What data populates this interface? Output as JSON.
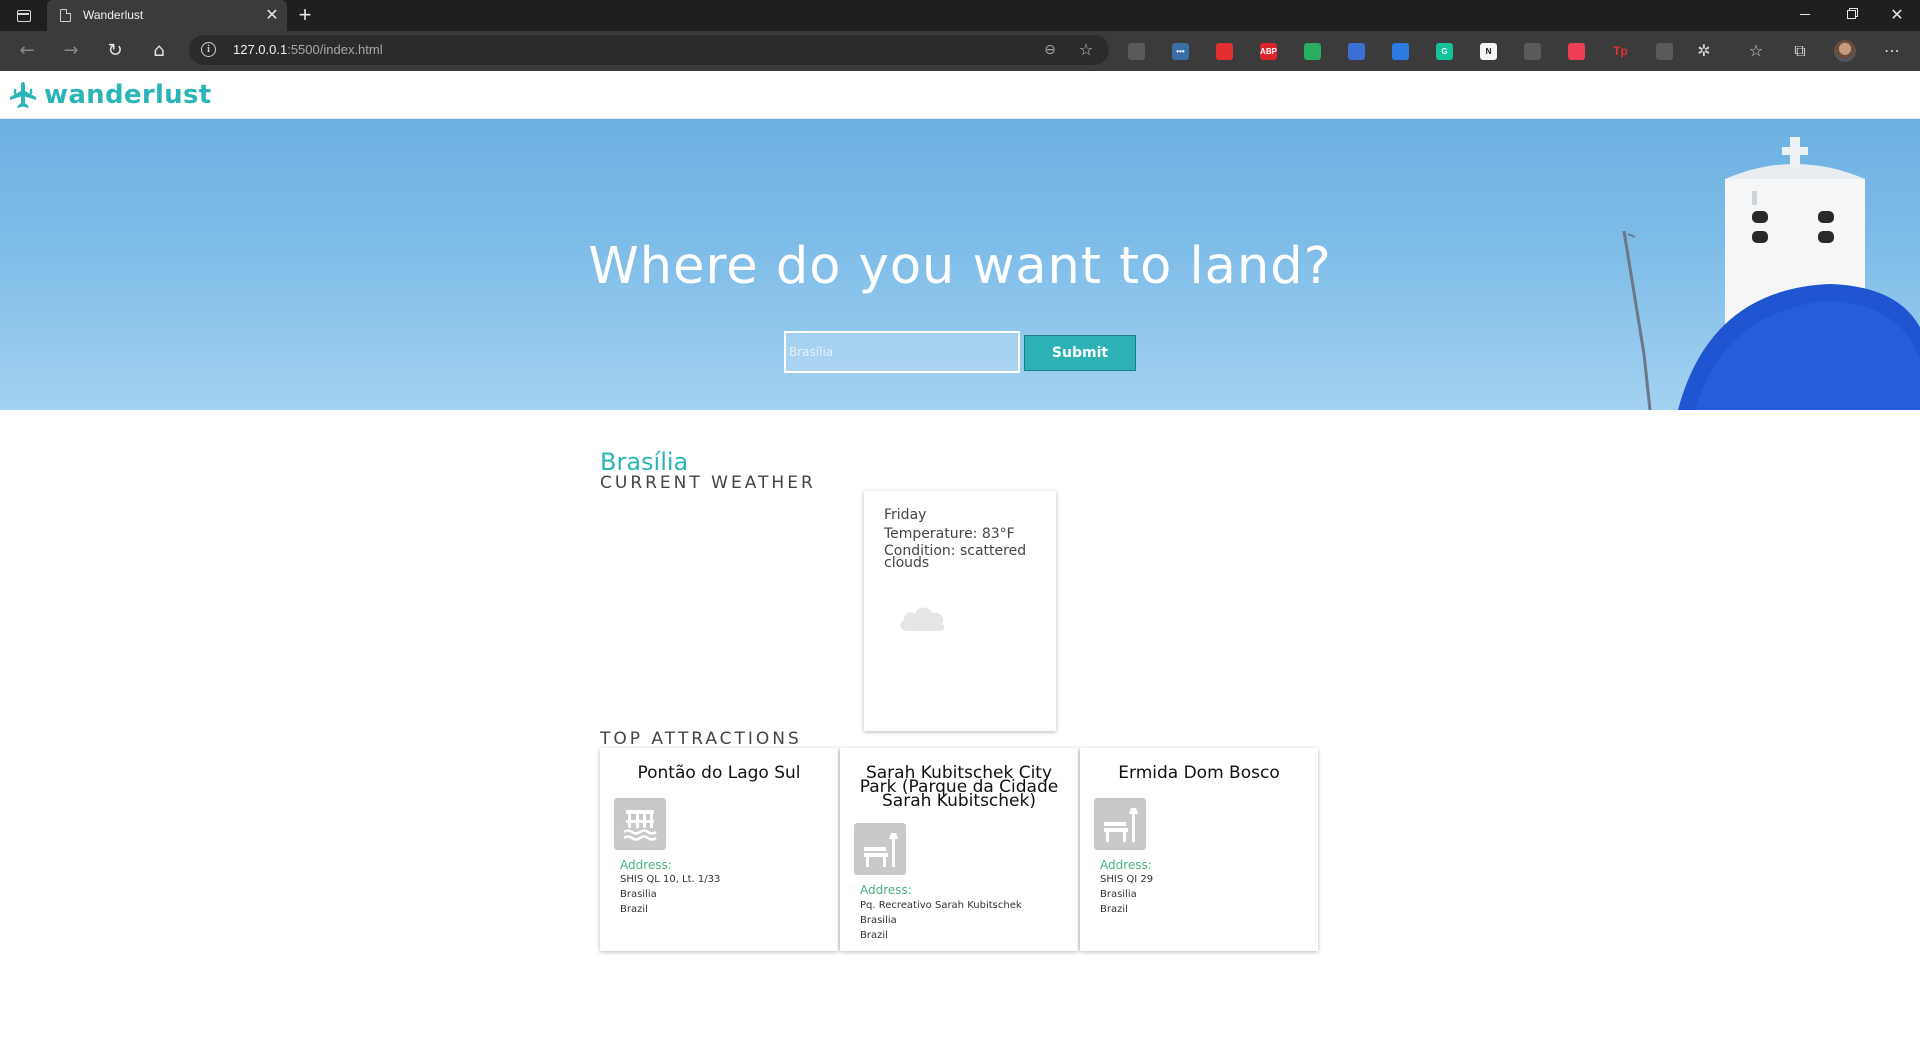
{
  "browser": {
    "tab_title": "Wanderlust",
    "url_host": "127.0.0.1",
    "url_rest": ":5500/index.html",
    "extensions": [
      {
        "name": "feather-ext-icon",
        "color": "#5a5a5a",
        "label": ""
      },
      {
        "name": "dots-ext-icon",
        "color": "#3a6ea5",
        "label": "•••"
      },
      {
        "name": "stop-hand-ext-icon",
        "color": "#e23030",
        "label": ""
      },
      {
        "name": "adblock-plus-ext-icon",
        "color": "#d9252a",
        "label": "ABP"
      },
      {
        "name": "shield-ext-icon",
        "color": "#27ae60",
        "label": ""
      },
      {
        "name": "translate-ext-icon",
        "color": "#3b6fd6",
        "label": ""
      },
      {
        "name": "timer-ext-icon",
        "color": "#2d7be0",
        "label": ""
      },
      {
        "name": "grammarly-ext-icon",
        "color": "#15c39a",
        "label": "G"
      },
      {
        "name": "notion-ext-icon",
        "color": "#f5f5f5",
        "label": "N"
      },
      {
        "name": "reader-ext-icon",
        "color": "#5a5a5a",
        "label": ""
      },
      {
        "name": "pocket-ext-icon",
        "color": "#ef3f56",
        "label": ""
      },
      {
        "name": "tp-ext-icon",
        "color": "#3b3b3b",
        "label": "Tp"
      },
      {
        "name": "collections-ext-icon",
        "color": "#5a5a5a",
        "label": ""
      }
    ]
  },
  "brand": {
    "name": "wanderlust",
    "color": "#2bb5b8"
  },
  "hero": {
    "headline": "Where do you want to land?",
    "search_placeholder": "Brasília",
    "submit_label": "Submit"
  },
  "city": {
    "name": "Brasília"
  },
  "weather": {
    "section_title": "CURRENT WEATHER",
    "day": "Friday",
    "temperature": "Temperature: 83°F",
    "condition": "Condition: scattered clouds",
    "icon": "cloud-icon"
  },
  "attractions": {
    "section_title": "TOP ATTRACTIONS",
    "items": [
      {
        "name": "Pontão do Lago Sul",
        "icon": "pier-icon",
        "address_label": "Address:",
        "address": [
          "SHIS QL 10, Lt. 1/33",
          "Brasilia",
          "Brazil"
        ]
      },
      {
        "name": "Sarah Kubitschek City Park (Parque da Cidade Sarah Kubitschek)",
        "icon": "park-bench-icon",
        "address_label": "Address:",
        "address": [
          "Pq. Recreativo Sarah Kubitschek",
          "Brasilia",
          "Brazil"
        ]
      },
      {
        "name": "Ermida Dom Bosco",
        "icon": "park-bench-icon",
        "address_label": "Address:",
        "address": [
          "SHIS QI 29",
          "Brasilia",
          "Brazil"
        ]
      }
    ]
  }
}
